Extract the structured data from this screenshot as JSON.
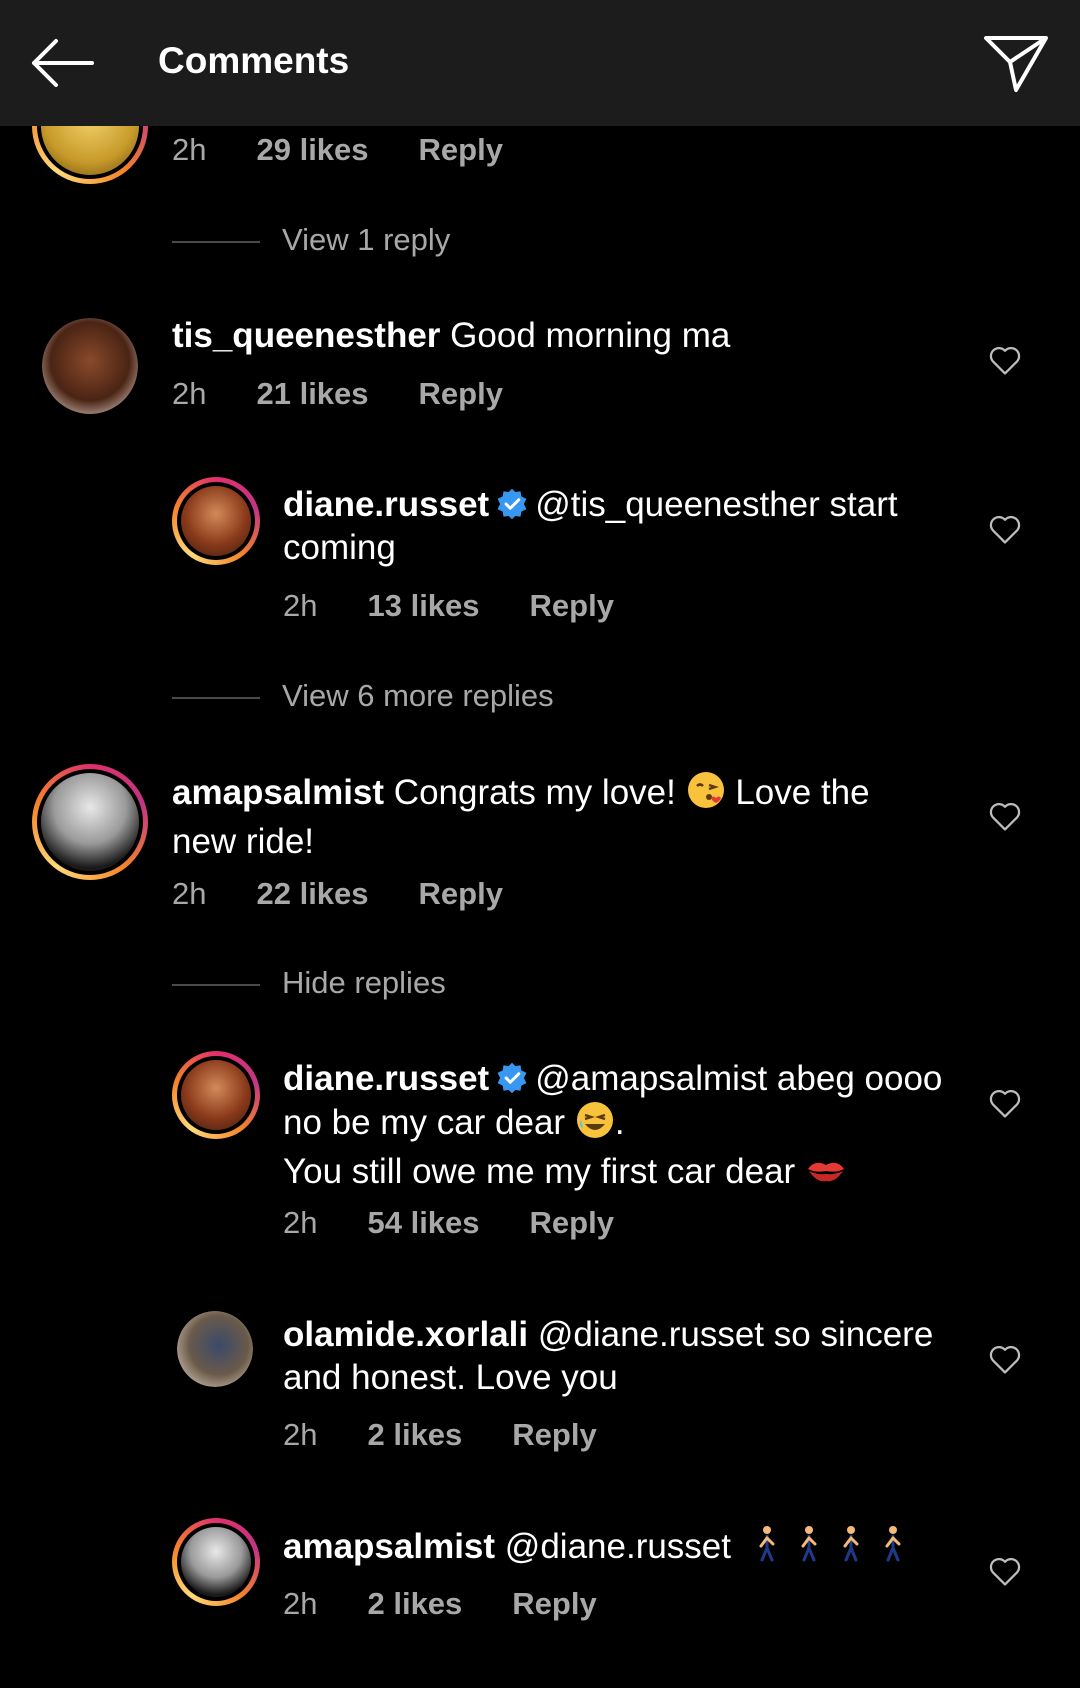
{
  "header": {
    "title": "Comments"
  },
  "comments": [
    {
      "time": "2h",
      "likes": "29 likes",
      "reply": "Reply",
      "view_replies": "View 1 reply"
    },
    {
      "username": "tis_queenesther",
      "text": "Good morning ma",
      "time": "2h",
      "likes": "21 likes",
      "reply": "Reply"
    },
    {
      "username": "diane.russet",
      "mention": "@tis_queenesther",
      "text": "start coming",
      "time": "2h",
      "likes": "13 likes",
      "reply": "Reply",
      "view_replies": "View 6 more replies"
    },
    {
      "username": "amapsalmist",
      "text_a": "Congrats my love!",
      "text_b": "Love the new ride!",
      "emoji": "kissing-face",
      "time": "2h",
      "likes": "22 likes",
      "reply": "Reply",
      "hide_replies": "Hide replies"
    },
    {
      "username": "diane.russet",
      "mention": "@amapsalmist",
      "text_a": "abeg oooo  no be my car dear",
      "text_b": ".",
      "text_c": "You still owe me my first car dear",
      "time": "2h",
      "likes": "54 likes",
      "reply": "Reply"
    },
    {
      "username": "olamide.xorlali",
      "mention": "@diane.russet",
      "text": "so sincere and honest.  Love you",
      "time": "2h",
      "likes": "2 likes",
      "reply": "Reply"
    },
    {
      "username": "amapsalmist",
      "mention": "@diane.russet",
      "emoji": "walking-man x4",
      "time": "2h",
      "likes": "2 likes",
      "reply": "Reply"
    }
  ],
  "colors": {
    "background": "#000000",
    "header": "#1c1c1c",
    "muted": "#a8a8a8",
    "verified": "#3897f0"
  }
}
